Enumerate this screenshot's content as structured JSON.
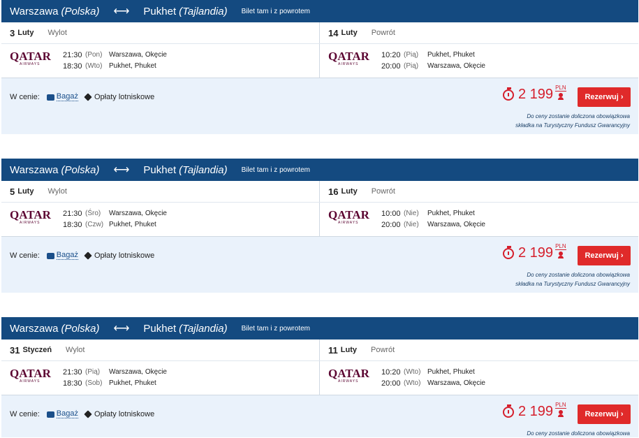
{
  "offers": [
    {
      "header": {
        "from_city": "Warszawa",
        "from_country": "(Polska)",
        "arrow": "⟷",
        "to_city": "Pukhet",
        "to_country": "(Tajlandia)",
        "ticket_type": "Bilet tam i z powrotem"
      },
      "outbound": {
        "day": "3",
        "month": "Luty",
        "label": "Wylot",
        "segments": [
          {
            "time": "21:30",
            "weekday": "(Pon)",
            "place": "Warszawa, Okęcie"
          },
          {
            "time": "18:30",
            "weekday": "(Wto)",
            "place": "Pukhet, Phuket"
          }
        ]
      },
      "inbound": {
        "day": "14",
        "month": "Luty",
        "label": "Powrót",
        "segments": [
          {
            "time": "10:20",
            "weekday": "(Pią)",
            "place": "Pukhet, Phuket"
          },
          {
            "time": "20:00",
            "weekday": "(Pią)",
            "place": "Warszawa, Okęcie"
          }
        ]
      },
      "price": {
        "included_label": "W cenie:",
        "baggage": "Bagaż",
        "fees": "Opłaty lotniskowe",
        "amount": "2 199",
        "currency": "PLN",
        "book": "Rezerwuj ›",
        "note_line1": "Do ceny zostanie doliczona obowiązkowa",
        "note_line2": "składka na Turystyczny Fundusz Gwarancyjny"
      }
    },
    {
      "header": {
        "from_city": "Warszawa",
        "from_country": "(Polska)",
        "arrow": "⟷",
        "to_city": "Pukhet",
        "to_country": "(Tajlandia)",
        "ticket_type": "Bilet tam i z powrotem"
      },
      "outbound": {
        "day": "5",
        "month": "Luty",
        "label": "Wylot",
        "segments": [
          {
            "time": "21:30",
            "weekday": "(Śro)",
            "place": "Warszawa, Okęcie"
          },
          {
            "time": "18:30",
            "weekday": "(Czw)",
            "place": "Pukhet, Phuket"
          }
        ]
      },
      "inbound": {
        "day": "16",
        "month": "Luty",
        "label": "Powrót",
        "segments": [
          {
            "time": "10:00",
            "weekday": "(Nie)",
            "place": "Pukhet, Phuket"
          },
          {
            "time": "20:00",
            "weekday": "(Nie)",
            "place": "Warszawa, Okęcie"
          }
        ]
      },
      "price": {
        "included_label": "W cenie:",
        "baggage": "Bagaż",
        "fees": "Opłaty lotniskowe",
        "amount": "2 199",
        "currency": "PLN",
        "book": "Rezerwuj ›",
        "note_line1": "Do ceny zostanie doliczona obowiązkowa",
        "note_line2": "składka na Turystyczny Fundusz Gwarancyjny"
      }
    },
    {
      "header": {
        "from_city": "Warszawa",
        "from_country": "(Polska)",
        "arrow": "⟷",
        "to_city": "Pukhet",
        "to_country": "(Tajlandia)",
        "ticket_type": "Bilet tam i z powrotem"
      },
      "outbound": {
        "day": "31",
        "month": "Styczeń",
        "label": "Wylot",
        "segments": [
          {
            "time": "21:30",
            "weekday": "(Pią)",
            "place": "Warszawa, Okęcie"
          },
          {
            "time": "18:30",
            "weekday": "(Sob)",
            "place": "Pukhet, Phuket"
          }
        ]
      },
      "inbound": {
        "day": "11",
        "month": "Luty",
        "label": "Powrót",
        "segments": [
          {
            "time": "10:20",
            "weekday": "(Wto)",
            "place": "Pukhet, Phuket"
          },
          {
            "time": "20:00",
            "weekday": "(Wto)",
            "place": "Warszawa, Okęcie"
          }
        ]
      },
      "price": {
        "included_label": "W cenie:",
        "baggage": "Bagaż",
        "fees": "Opłaty lotniskowe",
        "amount": "2 199",
        "currency": "PLN",
        "book": "Rezerwuj ›",
        "note_line1": "Do ceny zostanie doliczona obowiązkowa",
        "note_line2": ""
      }
    }
  ],
  "airline": {
    "name": "QATAR",
    "sub": "AIRWAYS"
  },
  "colors": {
    "header": "#144a80",
    "price": "#d51e2b",
    "button": "#e02a2a",
    "airline": "#5c0632"
  }
}
